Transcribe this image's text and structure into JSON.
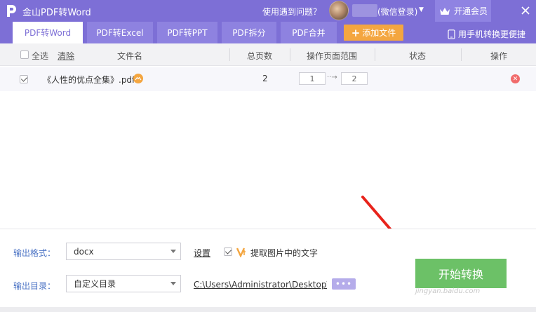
{
  "app": {
    "title": "金山PDF转Word",
    "help_text": "使用遇到问题？",
    "login_text": "(微信登录)",
    "vip_label": "开通会员",
    "accent": "#7d6fd6"
  },
  "tabs": [
    {
      "label": "PDF转Word",
      "active": true
    },
    {
      "label": "PDF转Excel",
      "active": false
    },
    {
      "label": "PDF转PPT",
      "active": false
    },
    {
      "label": "PDF拆分",
      "active": false
    },
    {
      "label": "PDF合并",
      "active": false
    }
  ],
  "toolbar": {
    "add_file_label": "添加文件",
    "mobile_link": "用手机转换更便捷"
  },
  "table": {
    "select_all": "全选",
    "clear": "清除",
    "headers": {
      "filename": "文件名",
      "pages": "总页数",
      "range": "操作页面范围",
      "status": "状态",
      "action": "操作"
    },
    "rows": [
      {
        "checked": true,
        "filename": "《人性的优点全集》.pdf",
        "pages": "2",
        "range_from": "1",
        "range_to": "2",
        "status": ""
      }
    ]
  },
  "output": {
    "format_label": "输出格式：",
    "format_value": "docx",
    "settings_label": "设置",
    "ocr_checked": true,
    "ocr_label": "提取图片中的文字",
    "dir_label": "输出目录：",
    "dir_value": "自定义目录",
    "path": "C:\\Users\\Administrator\\Desktop\\",
    "browse_label": "•••",
    "convert_label": "开始转换"
  },
  "watermark": "jingyan.baidu.com",
  "colors": {
    "primary": "#7d6fd6",
    "add_button": "#f4a640",
    "convert_button": "#6cc167",
    "remove_icon": "#f16b6b",
    "annotation_arrow": "#e8231b"
  }
}
